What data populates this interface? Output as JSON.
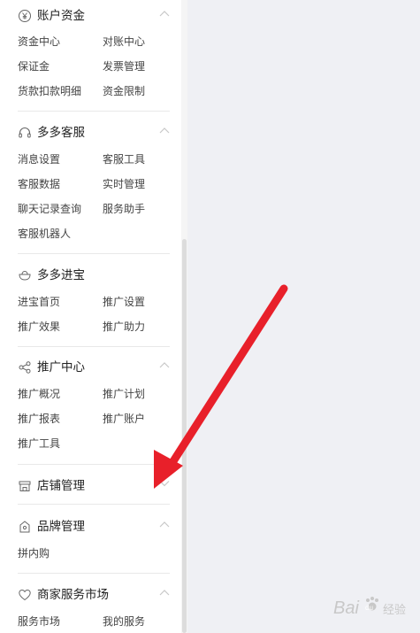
{
  "sections": [
    {
      "title": "账户资金",
      "icon": "yen-circle-icon",
      "items": [
        "资金中心",
        "对账中心",
        "保证金",
        "发票管理",
        "货款扣款明细",
        "资金限制"
      ]
    },
    {
      "title": "多多客服",
      "icon": "headset-icon",
      "items": [
        "消息设置",
        "客服工具",
        "客服数据",
        "实时管理",
        "聊天记录查询",
        "服务助手",
        "客服机器人"
      ]
    },
    {
      "title": "多多进宝",
      "icon": "treasure-bowl-icon",
      "items": [
        "进宝首页",
        "推广设置",
        "推广效果",
        "推广助力"
      ]
    },
    {
      "title": "推广中心",
      "icon": "share-icon",
      "items": [
        "推广概况",
        "推广计划",
        "推广报表",
        "推广账户",
        "推广工具"
      ]
    },
    {
      "title": "店铺管理",
      "icon": "shop-icon",
      "items": []
    },
    {
      "title": "品牌管理",
      "icon": "brand-tag-icon",
      "items": [
        "拼内购"
      ]
    },
    {
      "title": "商家服务市场",
      "icon": "heart-icon",
      "items": [
        "服务市场",
        "我的服务"
      ]
    }
  ],
  "watermark": {
    "brand": "Bai",
    "du": "du",
    "suffix": "经验"
  },
  "colors": {
    "arrow": "#e8202a",
    "accent_text": "#222222",
    "item_text": "#444444"
  }
}
